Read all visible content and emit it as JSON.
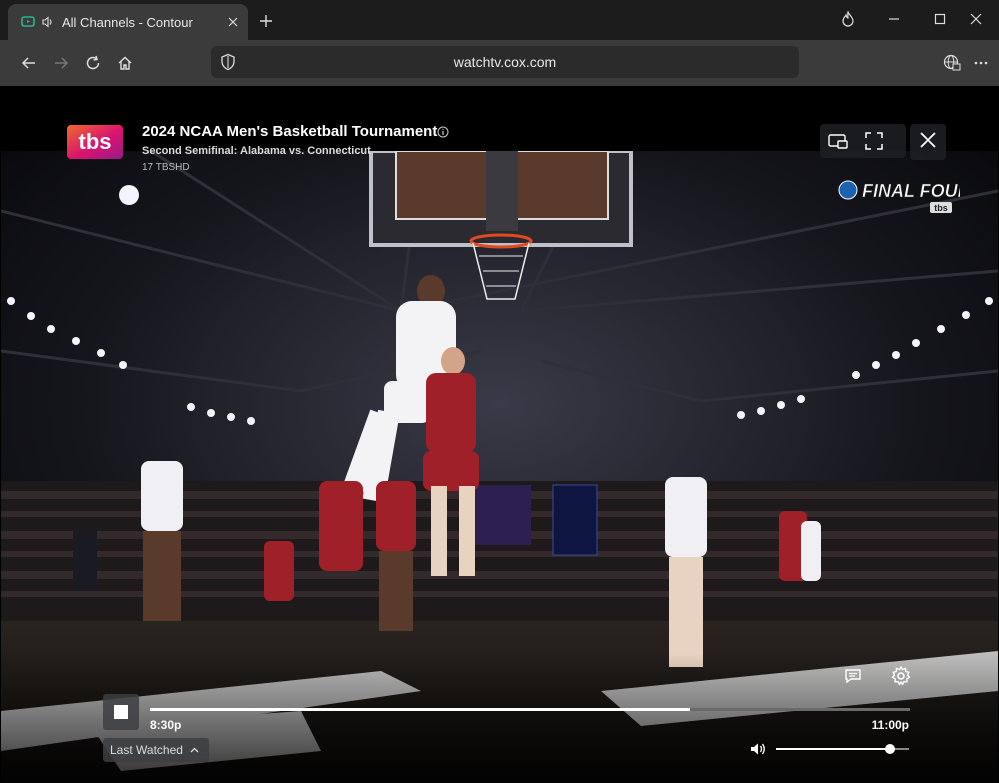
{
  "browser": {
    "tab_title": "All Channels - Contour",
    "url": "watchtv.cox.com"
  },
  "player": {
    "network_logo_text": "tbs",
    "show_title": "2024 NCAA Men's Basketball Tournament",
    "episode_title": "Second Semifinal: Alabama vs. Connecticut",
    "channel": "17 TBSHD",
    "bug_logo_text": "FINAL FOUR",
    "bug_logo_small": "tbs",
    "time_start": "8:30p",
    "time_end": "11:00p",
    "progress": 0.71,
    "volume": 0.86,
    "last_watched_label": "Last Watched"
  },
  "colors": {
    "titlebar": "#1c1c1c",
    "toolbar": "#3b3b3b",
    "accent_tbs_pink": "#d9136f"
  },
  "icons": [
    "tab-favicon-icon",
    "speaker-icon",
    "close-icon",
    "plus-icon",
    "flame-icon",
    "minimize-icon",
    "maximize-icon",
    "back-icon",
    "forward-icon",
    "refresh-icon",
    "home-icon",
    "shield-icon",
    "globe-icon",
    "more-icon",
    "info-icon",
    "picture-in-picture-icon",
    "fullscreen-icon",
    "closed-captions-icon",
    "gear-icon",
    "volume-icon",
    "chevron-up-icon"
  ]
}
